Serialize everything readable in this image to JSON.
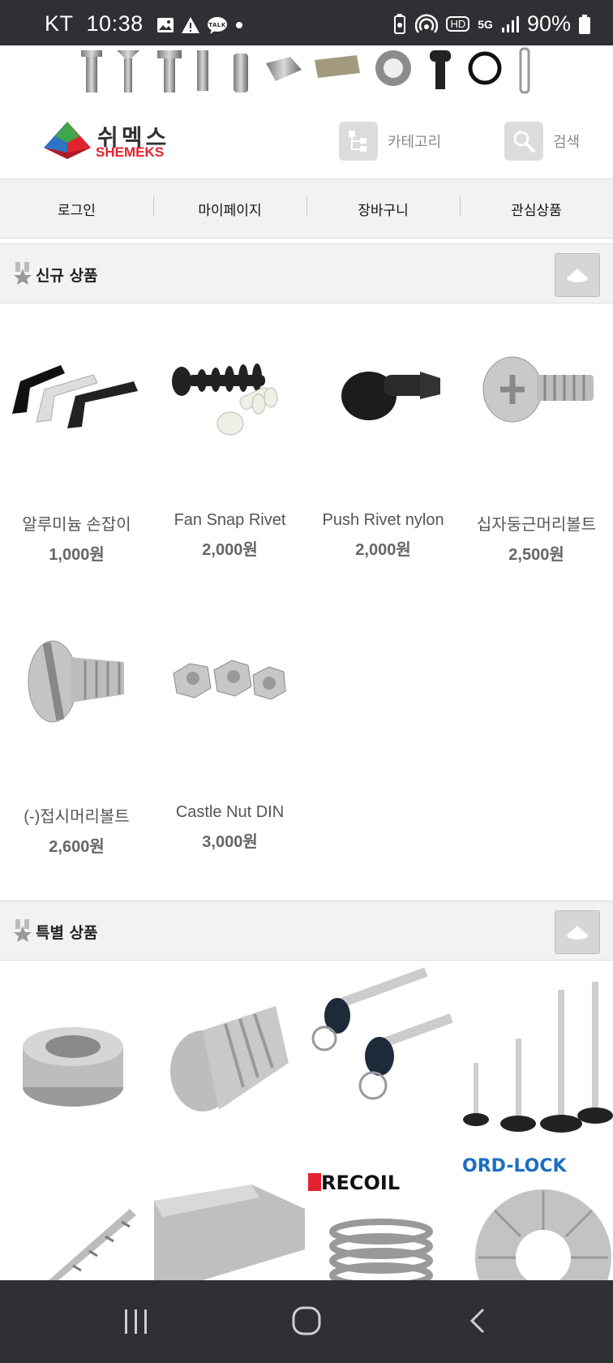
{
  "status_bar": {
    "carrier": "KT",
    "time": "10:38",
    "network": "5G",
    "hd": "HD",
    "battery": "90%"
  },
  "brand": {
    "name_ko": "쉬멕스",
    "name_en": "SHEMEKS"
  },
  "header": {
    "category_label": "카테고리",
    "search_label": "검색"
  },
  "nav": {
    "items": [
      {
        "label": "로그인"
      },
      {
        "label": "마이페이지"
      },
      {
        "label": "장바구니"
      },
      {
        "label": "관심상품"
      }
    ]
  },
  "new_products": {
    "title": "신규 상품",
    "items": [
      {
        "name": "알루미늄 손잡이",
        "price": "1,000원"
      },
      {
        "name": "Fan Snap Rivet",
        "price": "2,000원"
      },
      {
        "name": "Push Rivet nylon",
        "price": "2,000원"
      },
      {
        "name": "십자둥근머리볼트",
        "price": "2,500원"
      },
      {
        "name": "(-)접시머리볼트",
        "price": "2,600원"
      },
      {
        "name": "Castle Nut DIN",
        "price": "3,000원"
      }
    ]
  },
  "special_products": {
    "title": "특별 상품",
    "tile_texts": [
      "RECOIL",
      "ORD-LOCK"
    ]
  },
  "colors": {
    "statusbar_bg": "#2f3033",
    "brand_red": "#e2232e",
    "section_bg": "#f2f2f2"
  }
}
